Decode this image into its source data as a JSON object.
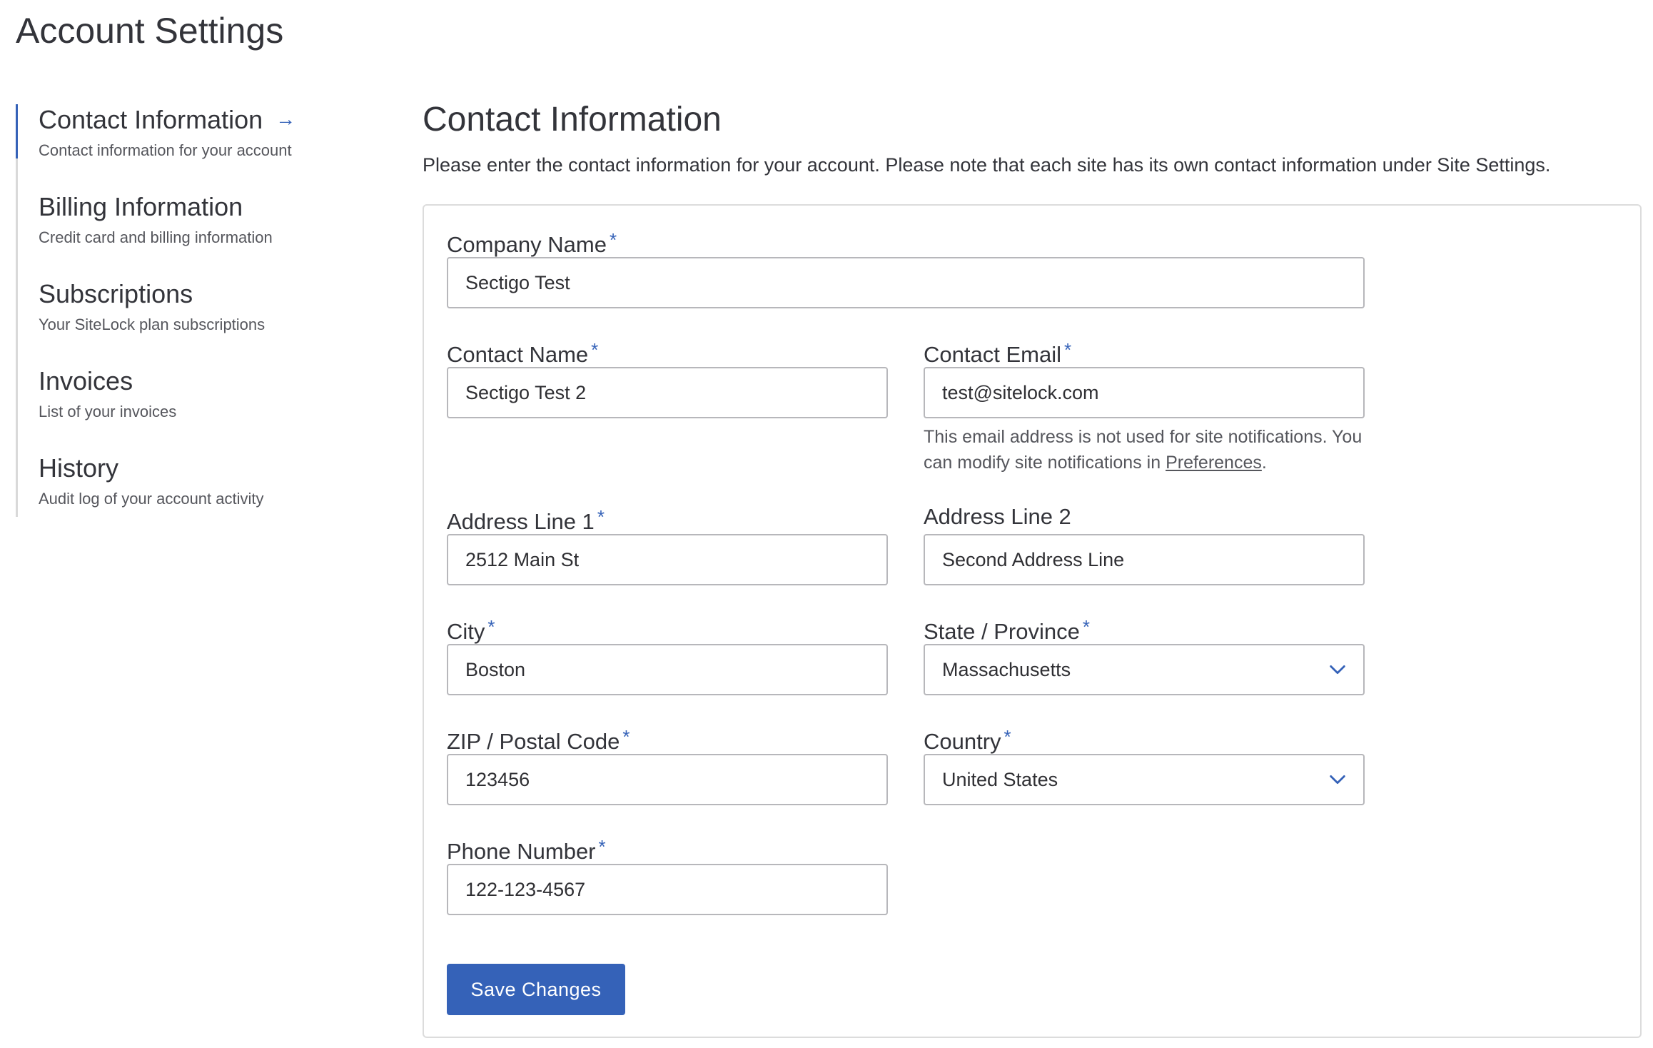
{
  "page": {
    "title": "Account Settings"
  },
  "sidebar": {
    "items": [
      {
        "label": "Contact Information",
        "description": "Contact information for your account",
        "active": true
      },
      {
        "label": "Billing Information",
        "description": "Credit card and billing information"
      },
      {
        "label": "Subscriptions",
        "description": "Your SiteLock plan subscriptions"
      },
      {
        "label": "Invoices",
        "description": "List of your invoices"
      },
      {
        "label": "History",
        "description": "Audit log of your account activity"
      }
    ],
    "active_icon": "arrow-right-icon"
  },
  "main": {
    "title": "Contact Information",
    "description": "Please enter the contact information for your account. Please note that each site has its own contact information under Site Settings."
  },
  "form": {
    "required_marker": "*",
    "company_name": {
      "label": "Company Name",
      "value": "Sectigo Test"
    },
    "contact_name": {
      "label": "Contact Name",
      "value": "Sectigo Test 2"
    },
    "contact_email": {
      "label": "Contact Email",
      "value": "test@sitelock.com",
      "help_before": "This email address is not used for site notifications. You can modify site notifications in ",
      "help_link": "Preferences",
      "help_after": "."
    },
    "address_line_1": {
      "label": "Address Line 1",
      "value": "2512 Main St"
    },
    "address_line_2": {
      "label": "Address Line 2",
      "value": "Second Address Line"
    },
    "city": {
      "label": "City",
      "value": "Boston"
    },
    "state": {
      "label": "State / Province",
      "value": "Massachusetts"
    },
    "zip": {
      "label": "ZIP / Postal Code",
      "value": "123456"
    },
    "country": {
      "label": "Country",
      "value": "United States"
    },
    "phone": {
      "label": "Phone Number",
      "value": "122-123-4567"
    },
    "save_label": "Save Changes"
  },
  "colors": {
    "accent": "#3562b8",
    "border": "#b7b7bb",
    "text": "#33343a",
    "muted_text": "#55565c"
  }
}
